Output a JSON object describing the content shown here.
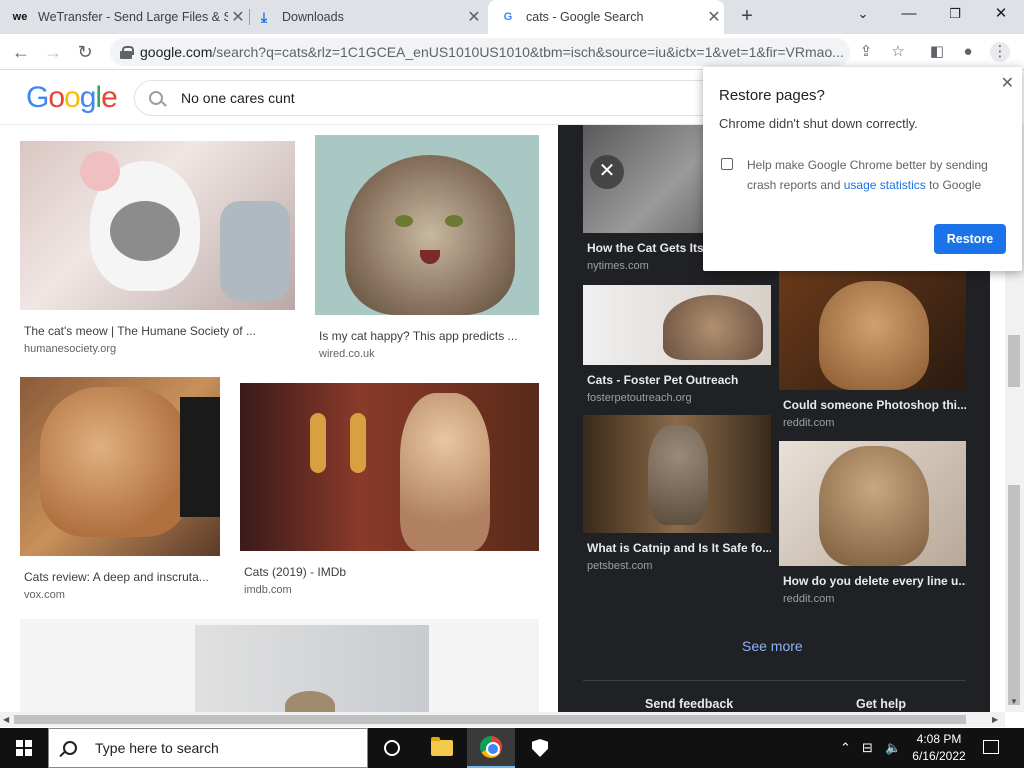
{
  "tabs": [
    {
      "favicon": "we",
      "title": "WeTransfer - Send Large Files & S"
    },
    {
      "favicon": "download-icon",
      "title": "Downloads"
    },
    {
      "favicon": "G",
      "title": "cats - Google Search"
    }
  ],
  "address": {
    "host": "google.com",
    "path": "/search?q=cats&rlz=1C1GCEA_enUS1010US1010&tbm=isch&source=iu&ictx=1&vet=1&fir=VRmao..."
  },
  "google": {
    "logo": "Google",
    "search_value": "No one cares cunt"
  },
  "results": [
    {
      "caption": "The cat's meow | The Humane Society of ...",
      "source": "humanesociety.org"
    },
    {
      "caption": "Is my cat happy? This app predicts ...",
      "source": "wired.co.uk"
    },
    {
      "caption": "Cats review: A deep and inscruta...",
      "source": "vox.com"
    },
    {
      "caption": "Cats (2019) - IMDb",
      "source": "imdb.com"
    }
  ],
  "preview": {
    "items": [
      {
        "title": "How the Cat Gets Its",
        "source": "nytimes.com"
      },
      {
        "title": "Cats - Foster Pet Outreach",
        "source": "fosterpetoutreach.org"
      },
      {
        "title": "Could someone Photoshop thi...",
        "source": "reddit.com"
      },
      {
        "title": "What is Catnip and Is It Safe fo...",
        "source": "petsbest.com"
      },
      {
        "title": "How do you delete every line u...",
        "source": "reddit.com"
      }
    ],
    "see_more": "See more",
    "send_feedback": "Send feedback",
    "get_help": "Get help"
  },
  "dialog": {
    "title": "Restore pages?",
    "message": "Chrome didn't shut down correctly.",
    "checkbox_text_1": "Help make Google Chrome better by sending crash reports and ",
    "checkbox_link": "usage statistics",
    "checkbox_text_2": " to Google",
    "button": "Restore"
  },
  "taskbar": {
    "search_placeholder": "Type here to search",
    "time": "4:08 PM",
    "date": "6/16/2022"
  },
  "colors": {
    "accent": "#1a73e8",
    "dark_panel": "#202124",
    "link_dark": "#8ab4f8"
  }
}
